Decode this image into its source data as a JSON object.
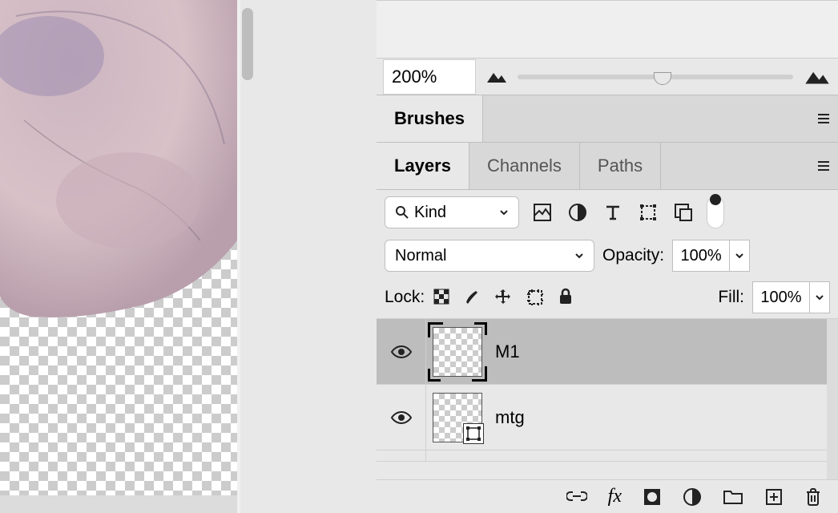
{
  "navigator": {
    "zoom_value": "200%"
  },
  "brushes_tab": {
    "label": "Brushes"
  },
  "layers_panel": {
    "tabs": {
      "layers": "Layers",
      "channels": "Channels",
      "paths": "Paths"
    },
    "filter": {
      "kind_label": "Kind"
    },
    "blend": {
      "mode": "Normal",
      "opacity_label": "Opacity:",
      "opacity_value": "100%"
    },
    "lock": {
      "label": "Lock:",
      "fill_label": "Fill:",
      "fill_value": "100%"
    },
    "layers": [
      {
        "name": "M1",
        "selected": true,
        "smart": false
      },
      {
        "name": "mtg",
        "selected": false,
        "smart": true
      }
    ]
  },
  "icons": {
    "search": "search",
    "image": "image",
    "circle_half": "adjustment",
    "text": "text",
    "shape": "shape",
    "smart": "smart-object",
    "pixels": "lock-pixels",
    "brush": "lock-brush",
    "move": "lock-position",
    "artboard": "lock-artboard",
    "lockall": "lock-all",
    "link": "link",
    "fx": "fx",
    "mask": "mask",
    "adjust": "adjustment-layer",
    "group": "group",
    "new": "new-layer",
    "trash": "delete"
  }
}
